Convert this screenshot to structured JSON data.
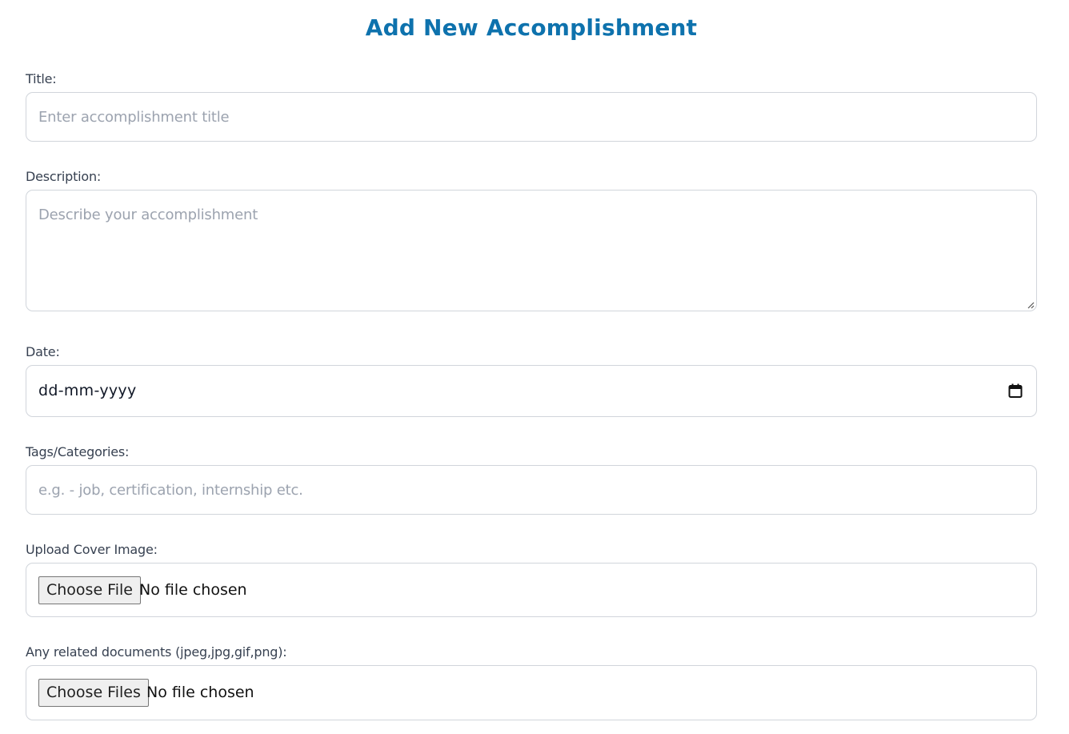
{
  "form": {
    "heading": "Add New Accomplishment",
    "title_field": {
      "label": "Title:",
      "placeholder": "Enter accomplishment title"
    },
    "description_field": {
      "label": "Description:",
      "placeholder": "Describe your accomplishment"
    },
    "date_field": {
      "label": "Date:",
      "value": "dd-mm-yyyy"
    },
    "tags_field": {
      "label": "Tags/Categories:",
      "placeholder": "e.g. - job, certification, internship etc."
    },
    "cover_image_field": {
      "label": "Upload Cover Image:",
      "button_label": "Choose File",
      "status": "No file chosen"
    },
    "documents_field": {
      "label": "Any related documents (jpeg,jpg,gif,png):",
      "button_label": "Choose Files",
      "status": "No file chosen"
    }
  },
  "colors": {
    "heading": "#0e72ad",
    "label": "#374151",
    "placeholder": "#9ca3af",
    "border": "#d1d5db"
  },
  "icons": {
    "date": "calendar-icon",
    "textarea": "resize-grip-icon"
  }
}
